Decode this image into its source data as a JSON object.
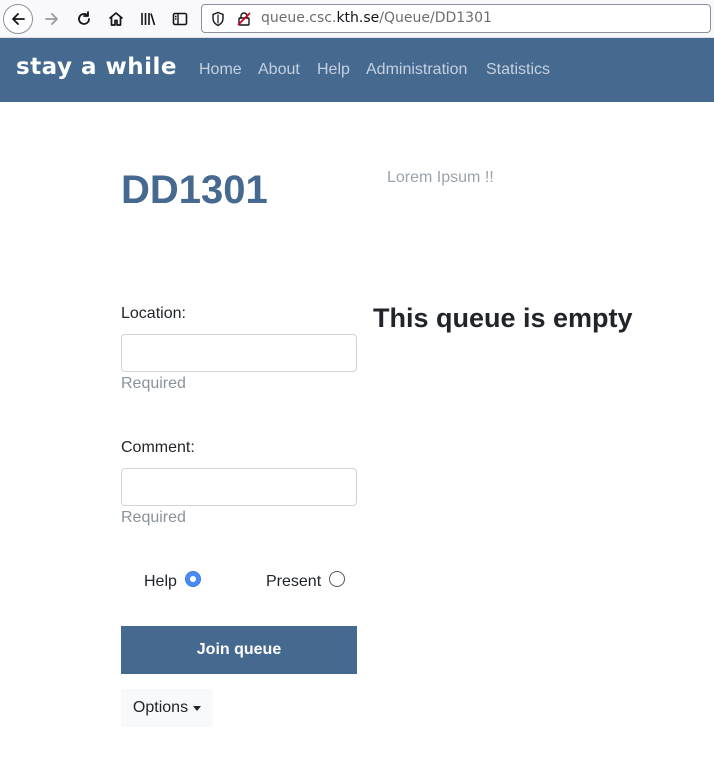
{
  "browser": {
    "url_prefix": "queue.csc.",
    "url_domain": "kth.se",
    "url_path": "/Queue/DD1301",
    "icons": [
      "back-arrow-icon",
      "forward-arrow-icon",
      "reload-icon",
      "home-icon",
      "library-icon",
      "sidebar-icon",
      "shield-icon",
      "insecure-lock-icon"
    ]
  },
  "navbar": {
    "brand": "stay a while",
    "links": [
      "Home",
      "About",
      "Help",
      "Administration",
      "Statistics"
    ],
    "color": "#46698f"
  },
  "queue": {
    "title": "DD1301",
    "description": "Lorem Ipsum !!",
    "empty_message": "This queue is empty"
  },
  "form": {
    "location_label": "Location:",
    "location_value": "",
    "location_hint": "Required",
    "comment_label": "Comment:",
    "comment_value": "",
    "comment_hint": "Required",
    "radio_help": "Help",
    "radio_present": "Present",
    "selected": "Help",
    "join_label": "Join queue",
    "options_label": "Options"
  }
}
